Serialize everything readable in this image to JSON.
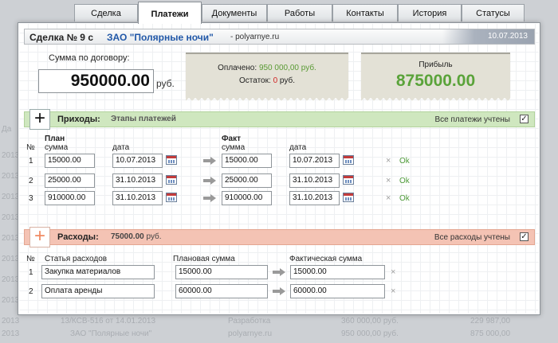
{
  "tabs": [
    {
      "label": "Сделка",
      "active": false
    },
    {
      "label": "Платежи",
      "active": true
    },
    {
      "label": "Документы",
      "active": false
    },
    {
      "label": "Работы",
      "active": false
    },
    {
      "label": "Контакты",
      "active": false
    },
    {
      "label": "История",
      "active": false
    },
    {
      "label": "Статусы",
      "active": false
    }
  ],
  "background": {
    "rows": [
      {
        "col1": "13/КСВ-516 от 14.01.2013",
        "col2": "Разработка",
        "col3": "360 000,00 руб.",
        "col4": "229 987,00"
      },
      {
        "col1": "ЗАО \"Полярные ночи\"",
        "col2": "polyarnye.ru",
        "col3": "950 000,00 руб.",
        "col4": "875 000,00"
      }
    ],
    "left_labels": [
      "Да",
      "2013",
      "2013",
      "2013",
      "2013",
      "2013",
      "2013",
      "2013",
      "2013",
      "2013",
      "2013",
      "2013"
    ]
  },
  "header": {
    "deal_title": "Сделка № 9 с",
    "client": "ЗАО \"Полярные ночи\"",
    "site": "- polyarnye.ru",
    "date": "10.07.2013"
  },
  "summary": {
    "contract_label": "Сумма по договору:",
    "contract_value": "950000.00",
    "currency": "руб.",
    "paid_label": "Оплачено:",
    "paid_value": "950 000,00 руб.",
    "remaining_label": "Остаток:",
    "remaining_value": "0",
    "remaining_currency": "руб.",
    "profit_label": "Прибыль",
    "profit_value": "875000.00"
  },
  "income": {
    "plus_label": "+",
    "title": "Приходы:",
    "subtitle": "Этапы платежей",
    "all_label": "Все платежи учтены",
    "checked": "✓",
    "num_header": "№",
    "plan_header": "План",
    "fact_header": "Факт",
    "sum_header": "сумма",
    "date_header": "дата",
    "rows": [
      {
        "n": "1",
        "plan_sum": "15000.00",
        "plan_date": "10.07.2013",
        "fact_sum": "15000.00",
        "fact_date": "10.07.2013",
        "ok": "Ok",
        "del": "×"
      },
      {
        "n": "2",
        "plan_sum": "25000.00",
        "plan_date": "31.10.2013",
        "fact_sum": "25000.00",
        "fact_date": "31.10.2013",
        "ok": "Ok",
        "del": "×"
      },
      {
        "n": "3",
        "plan_sum": "910000.00",
        "plan_date": "31.10.2013",
        "fact_sum": "910000.00",
        "fact_date": "31.10.2013",
        "ok": "Ok",
        "del": "×"
      }
    ]
  },
  "expenses": {
    "plus_label": "+",
    "title": "Расходы:",
    "total": "75000.00",
    "total_currency": "руб.",
    "all_label": "Все расходы учтены",
    "checked": "✓",
    "num_header": "№",
    "item_header": "Статья расходов",
    "plan_header": "Плановая сумма",
    "fact_header": "Фактическая сумма",
    "rows": [
      {
        "n": "1",
        "item": "Закупка материалов",
        "plan": "15000.00",
        "fact": "15000.00",
        "del": "×"
      },
      {
        "n": "2",
        "item": "Оплата аренды",
        "plan": "60000.00",
        "fact": "60000.00",
        "del": "×"
      }
    ]
  },
  "colors": {
    "accent_green": "#5aa33a",
    "link_blue": "#2158a8",
    "income_bar": "#cfe7bf",
    "expense_bar": "#f4c3b4"
  }
}
